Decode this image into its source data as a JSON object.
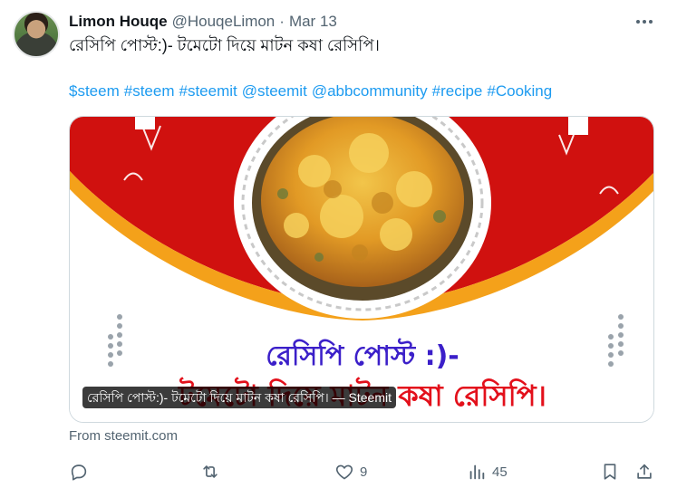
{
  "author": {
    "name": "Limon Houqe",
    "handle": "@HouqeLimon",
    "separator": "·",
    "date": "Mar 13"
  },
  "tweet": {
    "text": "রেসিপি পোস্ট:)- টমেটো দিয়ে মাটন কষা রেসিপি।",
    "hashtags": [
      "$steem",
      "#steem",
      "#steemit",
      "@steemit",
      "@abbcommunity",
      "#recipe",
      "#Cooking"
    ]
  },
  "card": {
    "image_title": "রেসিপি পোস্ট :)-",
    "image_subtitle": "টমেটো দিয়ে মাটন কষা রেসিপি।",
    "overlay_caption": "রেসিপি পোস্ট:)- টমেটো দিয়ে মাটন কষা রেসিপি। — Steemit",
    "source": "From steemit.com",
    "colors": {
      "banner": "#d0110f",
      "accent": "#f4a11a",
      "curry": "#e6a92d"
    }
  },
  "actions": {
    "reply_icon": "reply-icon",
    "retweet_icon": "retweet-icon",
    "like_icon": "heart-icon",
    "likes": "9",
    "views_icon": "views-icon",
    "views": "45",
    "bookmark_icon": "bookmark-icon",
    "share_icon": "share-icon"
  },
  "more_icon": "more-options-icon",
  "theme": {
    "link": "#1d9bf0",
    "muted": "#536471",
    "text": "#0f1419"
  }
}
